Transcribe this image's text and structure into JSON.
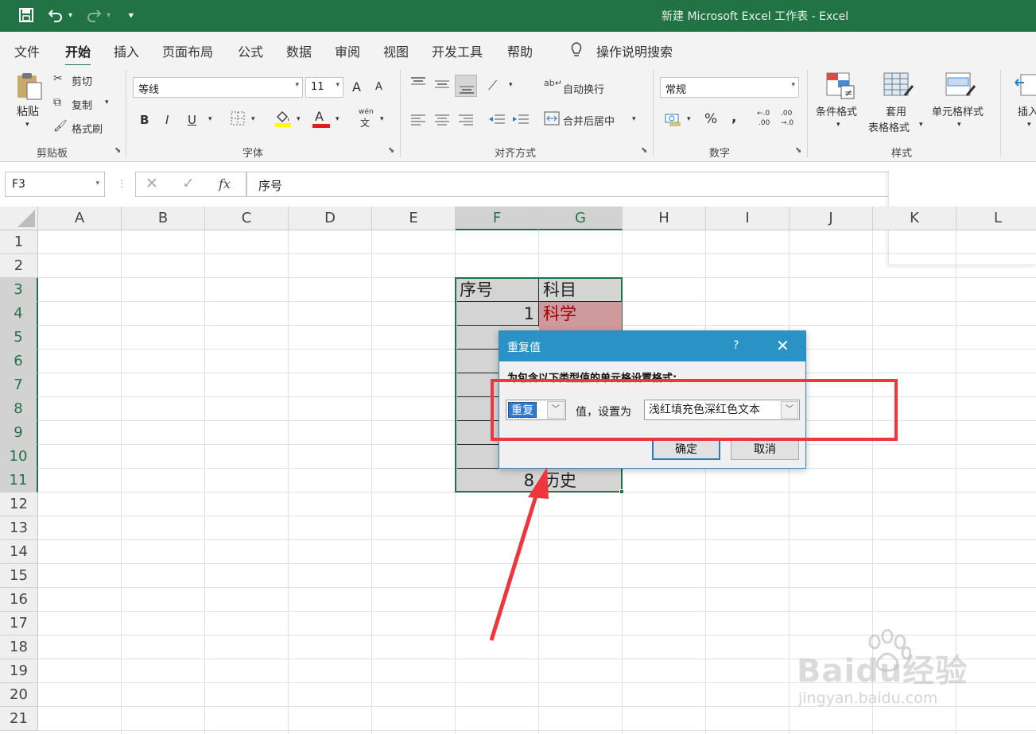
{
  "window": {
    "title": "新建 Microsoft Excel 工作表  -  Excel"
  },
  "quick_access": {
    "save_icon": "save-icon",
    "undo_icon": "undo-icon",
    "redo_icon": "redo-icon"
  },
  "tabs": [
    "文件",
    "开始",
    "插入",
    "页面布局",
    "公式",
    "数据",
    "审阅",
    "视图",
    "开发工具",
    "帮助"
  ],
  "active_tab": "开始",
  "tell_me": "操作说明搜索",
  "ribbon": {
    "clipboard": {
      "paste": "粘贴",
      "cut": "剪切",
      "copy": "复制",
      "format_painter": "格式刷",
      "label": "剪贴板"
    },
    "font": {
      "font_name": "等线",
      "font_size": "11",
      "bold": "B",
      "italic": "I",
      "underline": "U",
      "label": "字体",
      "grow": "A",
      "shrink": "A",
      "font_color": "A",
      "wen_top": "wén",
      "wen_char": "文"
    },
    "alignment": {
      "wrap_text": "自动换行",
      "merge_center": "合并后居中",
      "label": "对齐方式"
    },
    "number": {
      "format": "常规",
      "percent": "%",
      "comma": ",",
      "inc_decimal": "←.0",
      "inc_decimal_b": ".00",
      "dec_decimal": ".00",
      "dec_decimal_b": "→.0",
      "label": "数字"
    },
    "styles": {
      "conditional_formatting": "条件格式",
      "format_as_table_1": "套用",
      "format_as_table_2": "表格格式",
      "cell_styles": "单元格样式",
      "label": "样式"
    },
    "cells": {
      "insert": "插入"
    }
  },
  "formula_bar": {
    "name_box": "F3",
    "formula": "序号",
    "fx": "fx"
  },
  "columns": [
    "A",
    "B",
    "C",
    "D",
    "E",
    "F",
    "G",
    "H",
    "I",
    "J",
    "K",
    "L"
  ],
  "rows": [
    "1",
    "2",
    "3",
    "4",
    "5",
    "6",
    "7",
    "8",
    "9",
    "10",
    "11",
    "12",
    "13",
    "14",
    "15",
    "16",
    "17",
    "18",
    "19",
    "20",
    "21"
  ],
  "cells": {
    "F3": "序号",
    "G3": "科目",
    "F4": "1",
    "G4": "科学",
    "F11": "8",
    "G11": "历史"
  },
  "dialog": {
    "title": "重复值",
    "help": "?",
    "instruction": "为包含以下类型值的单元格设置格式:",
    "type_value": "重复",
    "middle_label": "值，设置为",
    "format_value": "浅红填充色深红色文本",
    "ok": "确定",
    "cancel": "取消"
  },
  "colors": {
    "excel_green": "#217346",
    "dialog_header": "#2b92c6",
    "highlight_fill": "#cf9a9d",
    "highlight_text": "#9c0006",
    "annotation_red": "#f0363d"
  },
  "watermark": {
    "brand": "Baidu经验",
    "url": "jingyan.baidu.com"
  }
}
